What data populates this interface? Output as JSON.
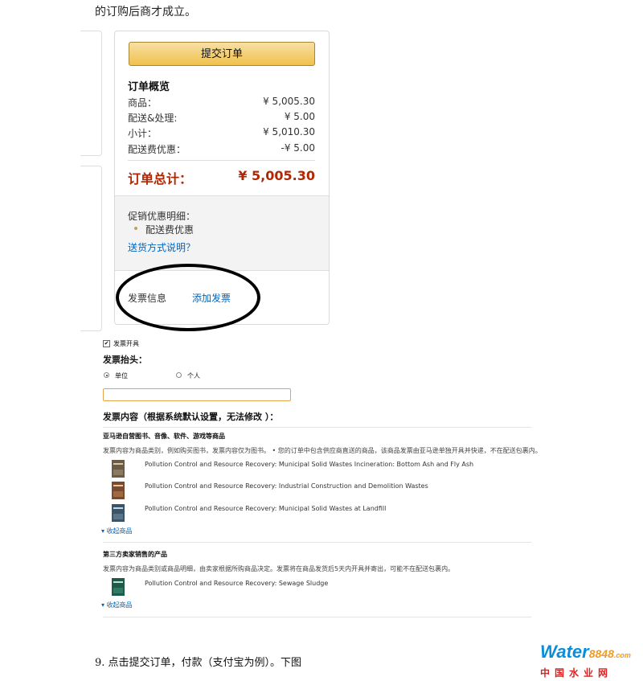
{
  "header": {
    "clipped_text": "的订购后商才成立。"
  },
  "summary": {
    "submit_label": "提交订单",
    "title": "订单概览",
    "rows": [
      {
        "label": "商品：",
        "value": "¥ 5,005.30"
      },
      {
        "label": "配送&处理:",
        "value": "¥ 5.00"
      },
      {
        "label": "小计：",
        "value": "¥ 5,010.30"
      },
      {
        "label": "配送费优惠：",
        "value": "-¥ 5.00"
      }
    ],
    "total_label": "订单总计：",
    "total_value": "¥ 5,005.30",
    "promo_title": "促销优惠明细：",
    "promo_item": "配送费优惠",
    "ship_link": "送货方式说明？",
    "invoice_label": "发票信息",
    "invoice_link": "添加发票"
  },
  "invoice": {
    "issue_label": "发票开具",
    "heading_label": "发票抬头：",
    "option_company": "单位",
    "option_personal": "个人",
    "content_label": "发票内容（根据系统默认设置，无法修改 ）：",
    "amazon_group_title": "亚马逊自营图书、音像、软件、游戏等商品",
    "amazon_note": "发票内容为商品类别，例如购买图书，发票内容仅为图书。 • 您的订单中包含供应商直送的商品，该商品发票由亚马逊单独开具并快递，不在配送包裹内。",
    "amazon_items": [
      {
        "title": "Pollution Control and Resource Recovery: Municipal Solid Wastes Incineration: Bottom Ash and Fly Ash",
        "cover_color": "#6a5a48"
      },
      {
        "title": "Pollution Control and Resource Recovery: Industrial Construction and Demolition Wastes",
        "cover_color": "#7a4a30"
      },
      {
        "title": "Pollution Control and Resource Recovery: Municipal Solid Wastes at Landfill",
        "cover_color": "#3a5468"
      }
    ],
    "collapse_label": "收起商品",
    "third_group_title": "第三方卖家销售的产品",
    "third_note": "发票内容为商品类别或商品明细，由卖家根据所购商品决定。发票将在商品发货后5天内开具并寄出，可能不在配送包裹内。",
    "third_items": [
      {
        "title": "Pollution Control and Resource Recovery: Sewage Sludge",
        "cover_color": "#1e5a4a"
      }
    ],
    "collapse_label_2": "收起商品"
  },
  "footer": {
    "step_text": "9. 点击提交订单，付款（支付宝为例）。下图"
  },
  "watermark": {
    "brand": "Water",
    "number": "8848",
    "suffix": ".com",
    "cn": "中国水业网"
  },
  "colors": {
    "accent_red": "#b12704",
    "link_blue": "#0066c0",
    "button_gold": "#f0c14b"
  }
}
